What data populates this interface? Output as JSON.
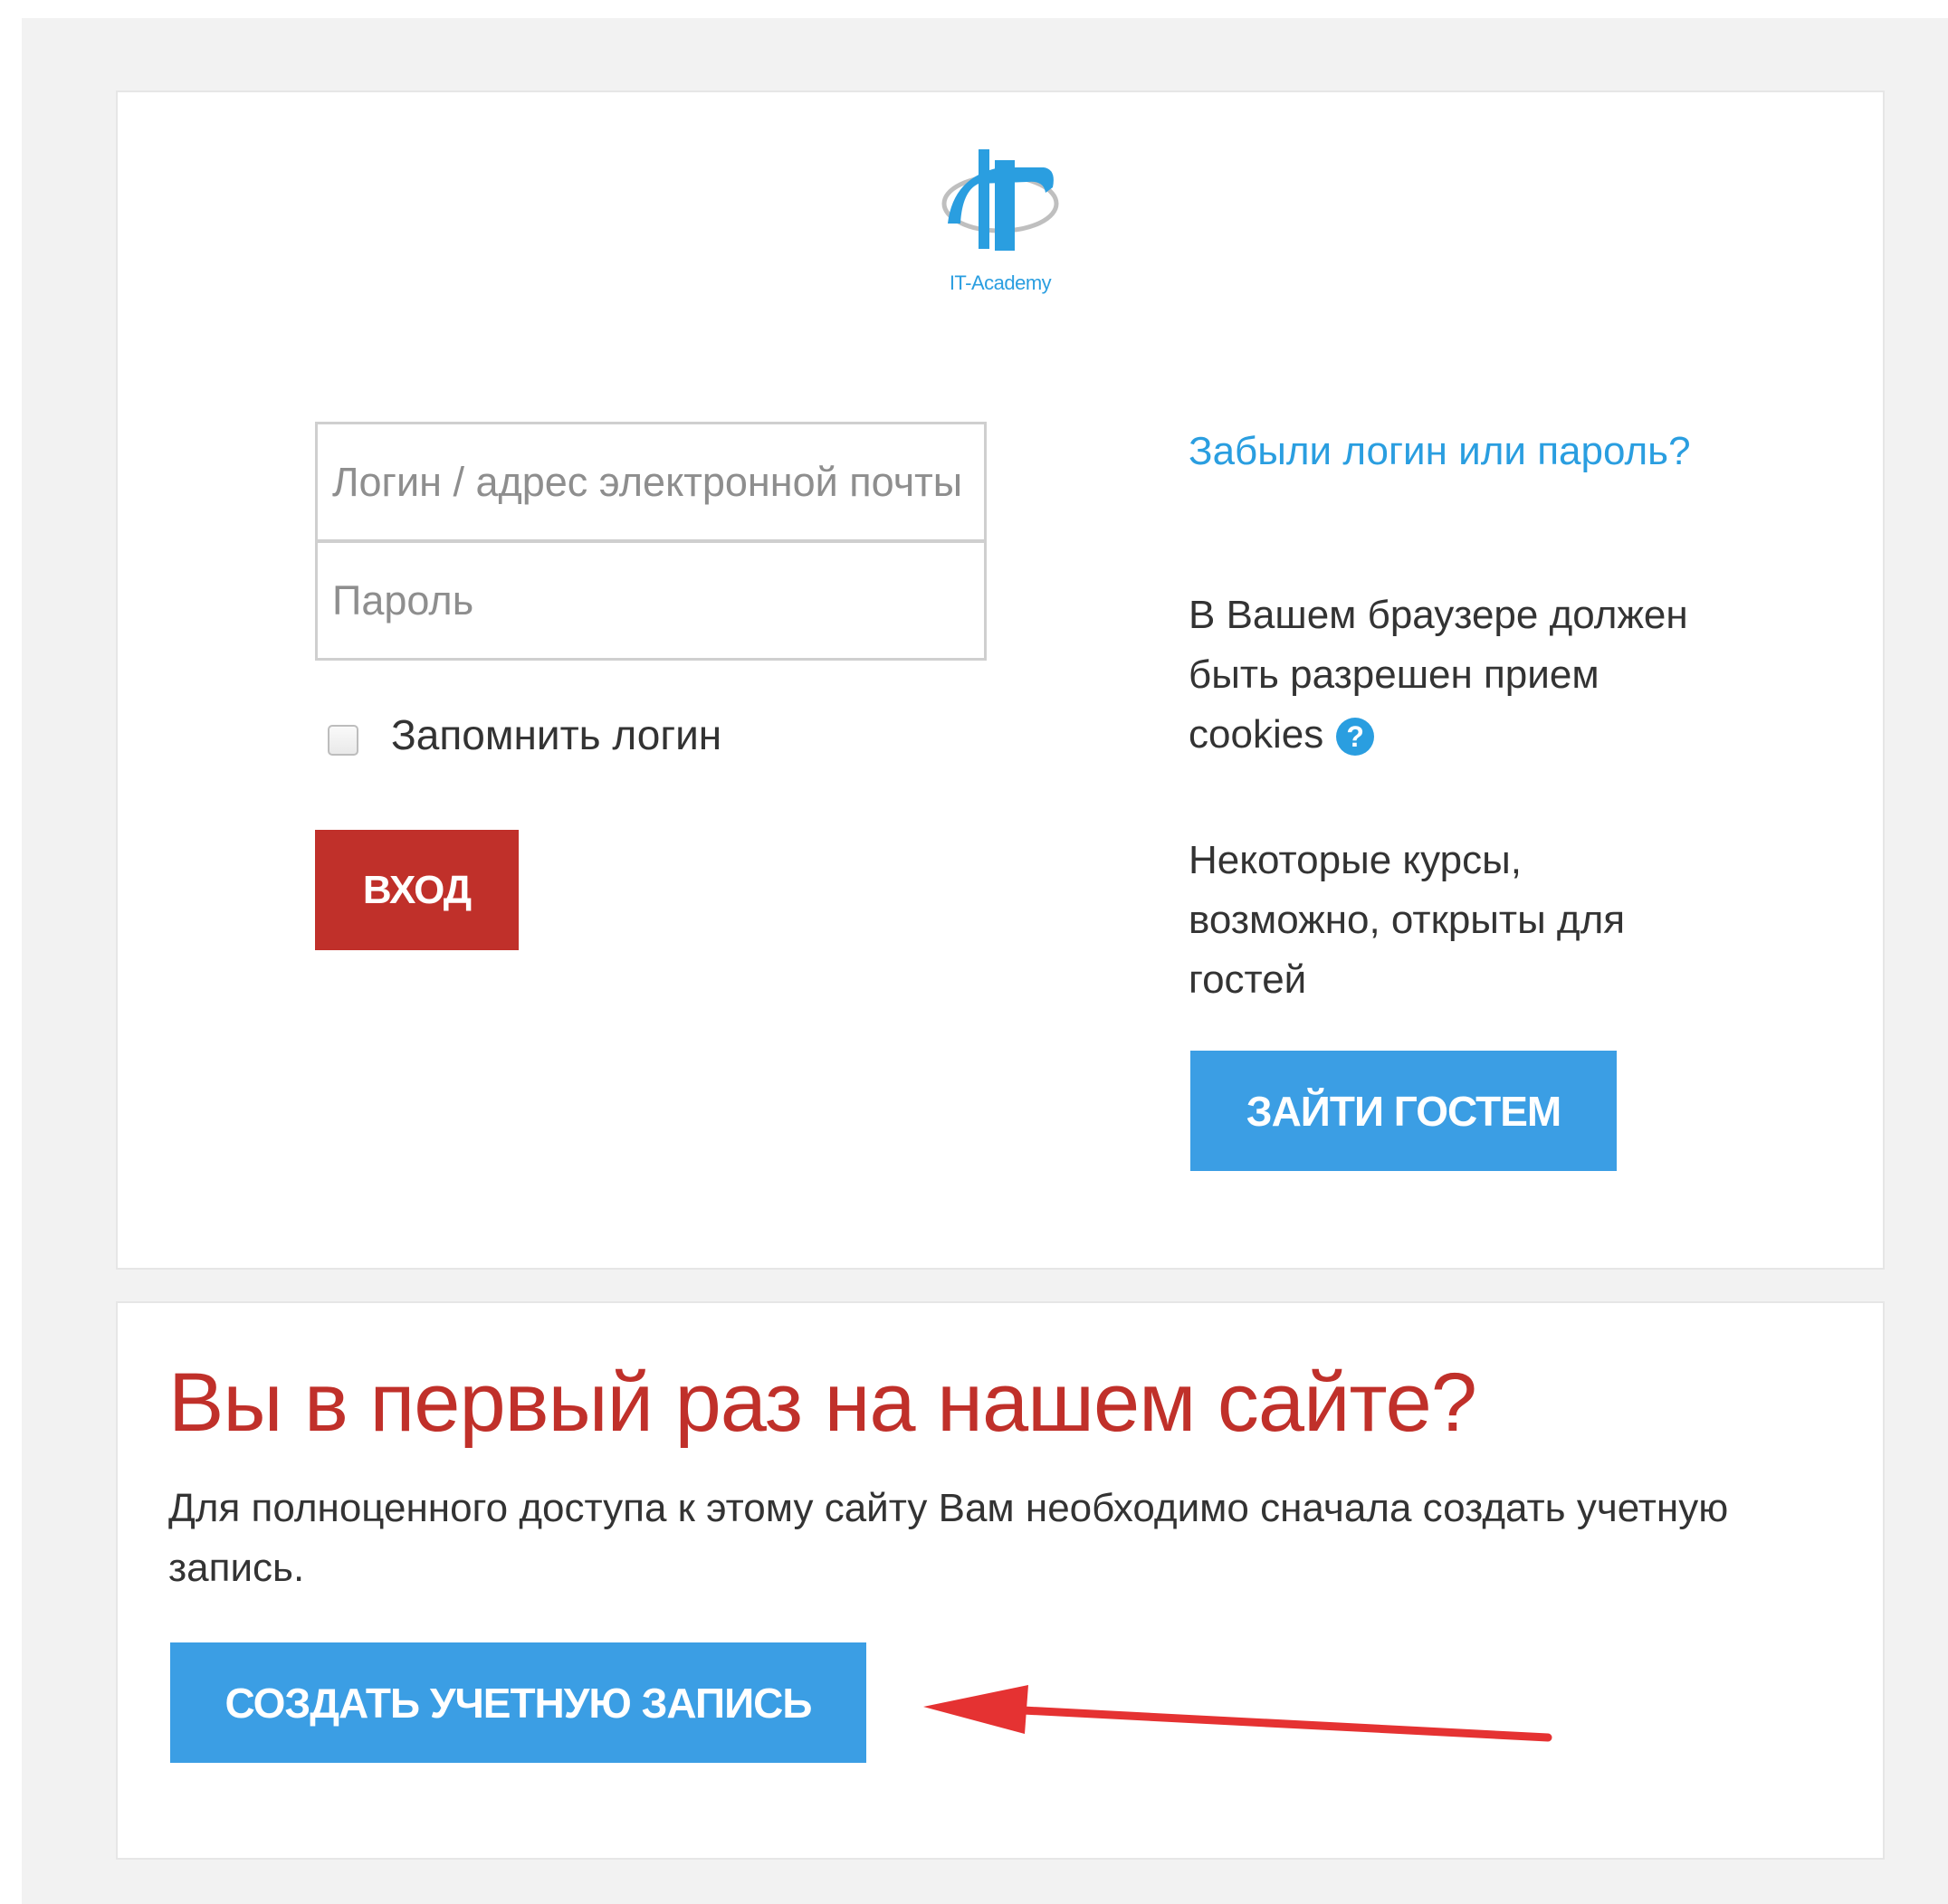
{
  "logo": {
    "caption": "IT-Academy",
    "color": "#2a9ee0"
  },
  "login_form": {
    "login_placeholder": "Логин / адрес электронной почты",
    "password_placeholder": "Пароль",
    "remember_label": "Запомнить логин",
    "submit_label": "ВХОД"
  },
  "side_info": {
    "forgot_link": "Забыли логин или пароль?",
    "cookies_text": "В Вашем браузере должен быть разрешен прием cookies",
    "help_icon": "question-circle-icon",
    "guests_text": "Некоторые курсы, возможно, открыты для гостей",
    "guest_button": "ЗАЙТИ ГОСТЕМ"
  },
  "signup": {
    "title": "Вы в первый раз на нашем сайте?",
    "description": "Для полноценного доступа к этому сайту Вам необходимо сначала создать учетную запись.",
    "create_button": "СОЗДАТЬ УЧЕТНУЮ ЗАПИСЬ"
  },
  "colors": {
    "accent_blue": "#3b9ee4",
    "danger_red": "#c0302a",
    "annotation_arrow": "#e53232"
  }
}
